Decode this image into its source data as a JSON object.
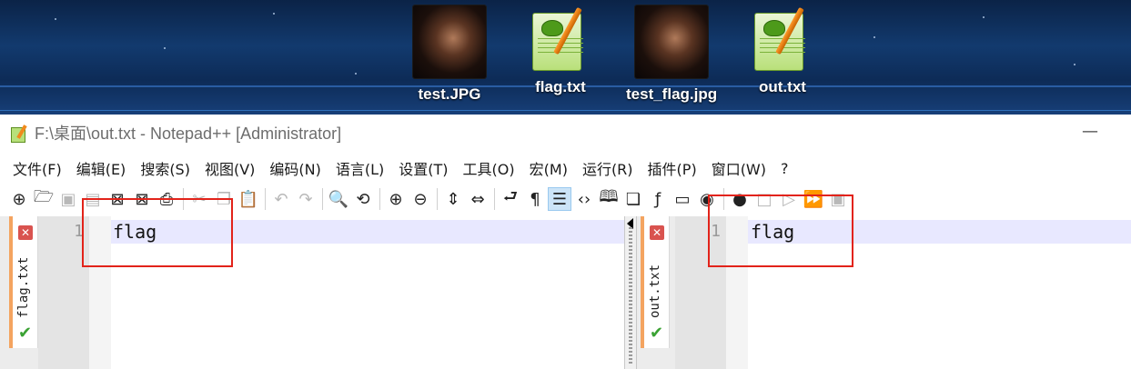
{
  "desktop": {
    "icons": [
      {
        "label": "test.JPG",
        "type": "image"
      },
      {
        "label": "flag.txt",
        "type": "notepad"
      },
      {
        "label": "test_flag.jpg",
        "type": "image"
      },
      {
        "label": "out.txt",
        "type": "notepad"
      }
    ]
  },
  "window": {
    "title": "F:\\桌面\\out.txt - Notepad++ [Administrator]",
    "minimize_label": "—"
  },
  "menu": {
    "items": [
      "文件(F)",
      "编辑(E)",
      "搜索(S)",
      "视图(V)",
      "编码(N)",
      "语言(L)",
      "设置(T)",
      "工具(O)",
      "宏(M)",
      "运行(R)",
      "插件(P)",
      "窗口(W)",
      "?"
    ]
  },
  "toolbar": {
    "icons": [
      "new-file-icon",
      "open-folder-icon",
      "save-icon",
      "save-all-icon",
      "close-icon",
      "close-all-icon",
      "print-icon",
      "cut-icon",
      "copy-icon",
      "paste-icon",
      "undo-icon",
      "redo-icon",
      "find-icon",
      "replace-icon",
      "zoom-in-icon",
      "zoom-out-icon",
      "sync-vertical-icon",
      "sync-horizontal-icon",
      "word-wrap-icon",
      "show-all-chars-icon",
      "indent-guide-icon",
      "xml-tag-icon",
      "document-map-icon",
      "document-list-icon",
      "function-list-icon",
      "folder-workspace-icon",
      "monitoring-icon",
      "record-macro-icon",
      "stop-record-icon",
      "play-macro-icon",
      "run-macro-multiple-icon",
      "save-macro-icon"
    ]
  },
  "editors": {
    "left": {
      "tab_label": "flag.txt",
      "line_number": "1",
      "text": "flag"
    },
    "right": {
      "tab_label": "out.txt",
      "line_number": "1",
      "text": "flag"
    }
  },
  "colors": {
    "highlight_box": "#e2231a",
    "current_line": "#e8e8ff",
    "tab_accent": "#f4a460"
  }
}
